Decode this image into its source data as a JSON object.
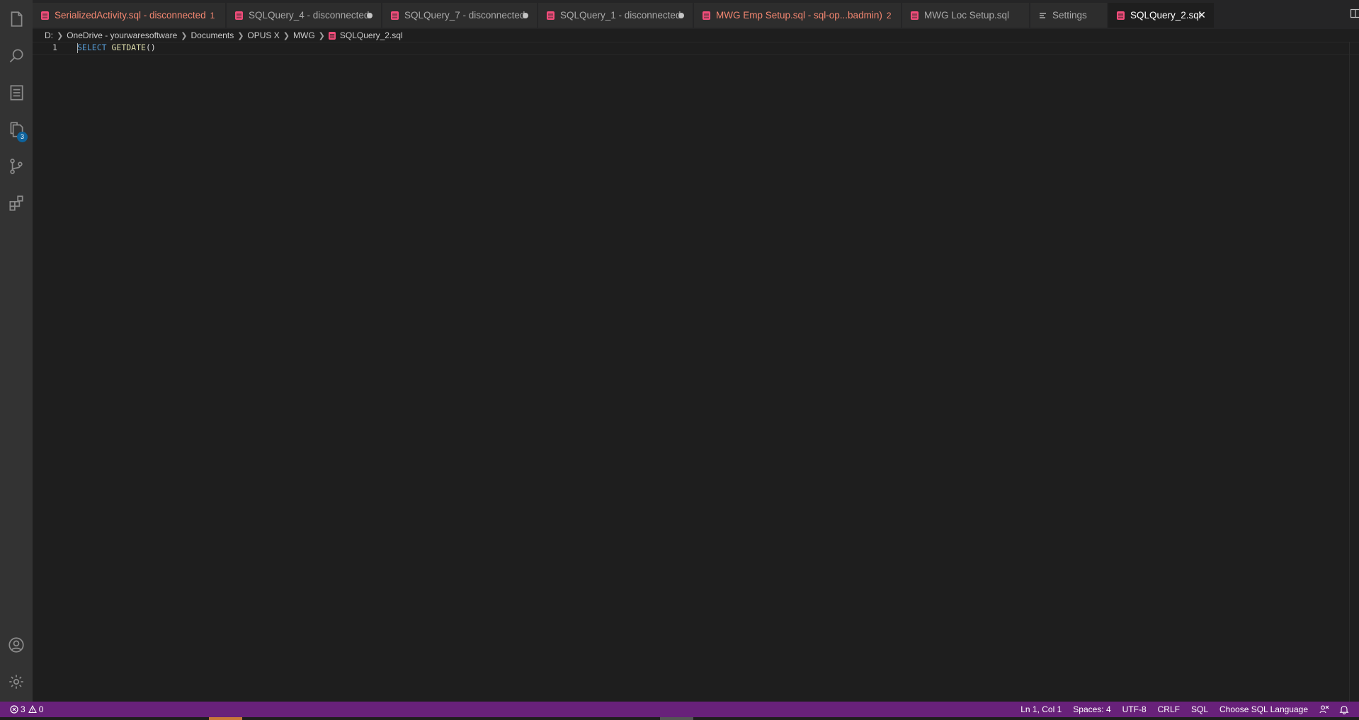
{
  "activity_bar": {
    "items": [
      {
        "name": "explorer-icon"
      },
      {
        "name": "search-icon"
      },
      {
        "name": "notebook-icon"
      },
      {
        "name": "open-editors-icon",
        "badge": "3"
      },
      {
        "name": "source-control-icon"
      },
      {
        "name": "extensions-icon"
      }
    ],
    "bottom": [
      {
        "name": "account-icon"
      },
      {
        "name": "manage-gear-icon"
      }
    ]
  },
  "tabs": [
    {
      "label": "SerializedActivity.sql - disconnected",
      "count": "1",
      "error": true,
      "dirty": false,
      "icon": "sql-file-icon"
    },
    {
      "label": "SQLQuery_4 - disconnected",
      "count": "",
      "error": false,
      "dirty": true,
      "icon": "sql-file-icon"
    },
    {
      "label": "SQLQuery_7 - disconnected",
      "count": "",
      "error": false,
      "dirty": true,
      "icon": "sql-file-icon"
    },
    {
      "label": "SQLQuery_1 - disconnected",
      "count": "",
      "error": false,
      "dirty": true,
      "icon": "sql-file-icon"
    },
    {
      "label": "MWG Emp Setup.sql - sql-op...badmin)",
      "count": "2",
      "error": true,
      "dirty": false,
      "icon": "sql-file-icon"
    },
    {
      "label": "MWG Loc Setup.sql",
      "count": "",
      "error": false,
      "dirty": false,
      "icon": "sql-file-icon"
    },
    {
      "label": "Settings",
      "count": "",
      "error": false,
      "dirty": false,
      "icon": "settings-lines-icon"
    },
    {
      "label": "SQLQuery_2.sql",
      "count": "",
      "error": false,
      "dirty": false,
      "active": true,
      "icon": "sql-file-icon"
    }
  ],
  "tab_actions": {
    "split": "split-editor-icon",
    "more": "..."
  },
  "breadcrumb": [
    "D:",
    "OneDrive - yourwaresoftware",
    "Documents",
    "OPUS X",
    "MWG",
    "SQLQuery_2.sql"
  ],
  "editor": {
    "line_number": "1",
    "tokens": {
      "keyword": "SELECT",
      "space": " ",
      "function": "GETDATE",
      "parens": "()"
    }
  },
  "status_bar": {
    "errors": "3",
    "warnings": "0",
    "position": "Ln 1, Col 1",
    "spaces": "Spaces: 4",
    "encoding": "UTF-8",
    "eol": "CRLF",
    "language": "SQL",
    "choose_language": "Choose SQL Language"
  },
  "colors": {
    "status_bar": "#68217a",
    "error_text": "#f48771",
    "sql_icon": "#f14c7a",
    "keyword": "#569cd6",
    "function": "#dcdcaa"
  }
}
